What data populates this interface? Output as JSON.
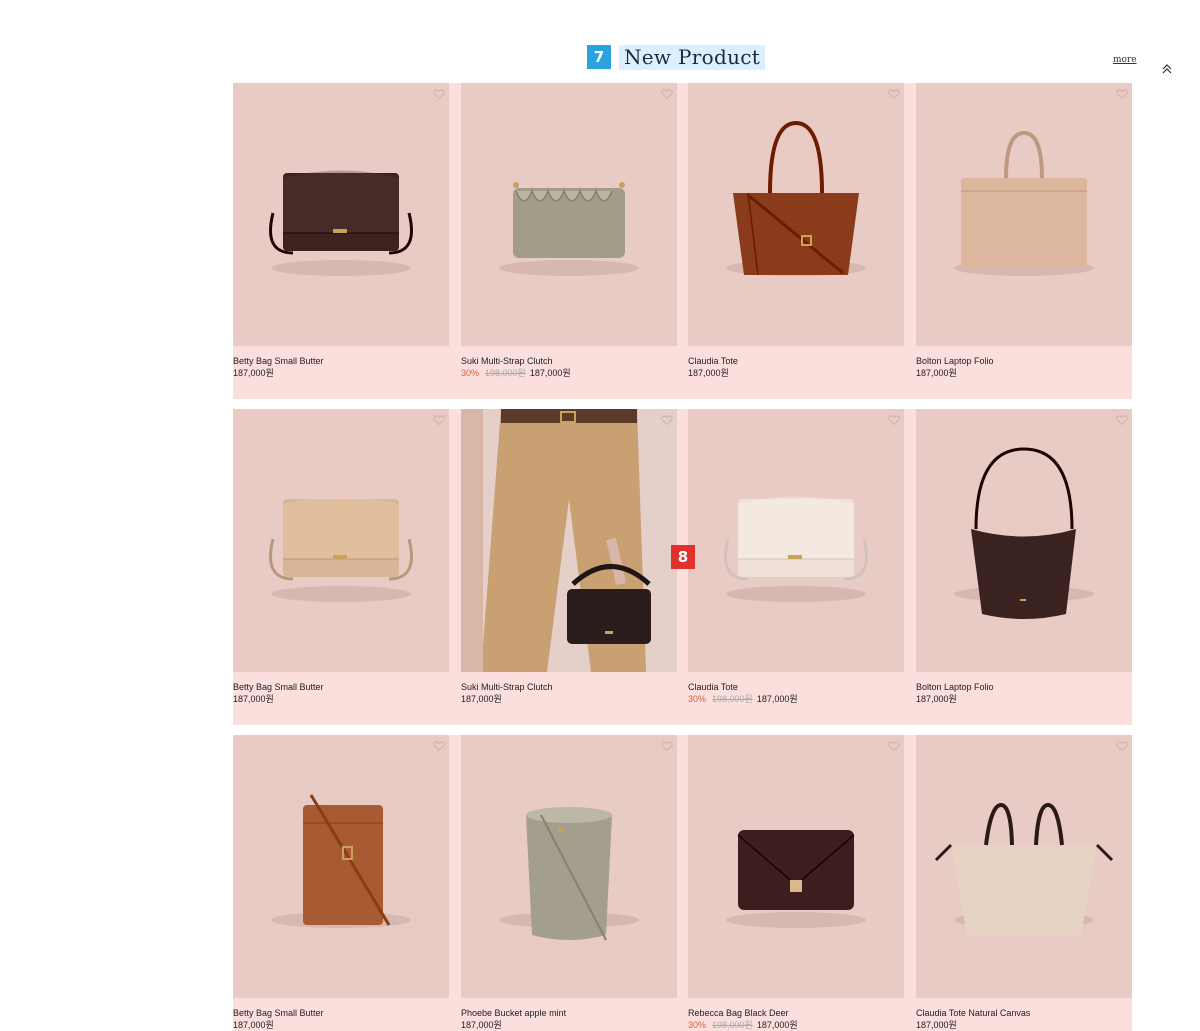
{
  "section": {
    "badge_top": "7",
    "title": "New Product",
    "more_label": "more",
    "badge_mid": "8"
  },
  "colors": {
    "card_bg": "#e9cbc6",
    "row_bg": "#fbdfdd",
    "discount": "#d9603a",
    "title_highlight": "#dcefff"
  },
  "products": [
    {
      "name": "Betty Bag Small Butter",
      "discount": "",
      "original_price": "",
      "price": "187,000원",
      "bag_color": "#3e2220",
      "style": "flap-crossbody"
    },
    {
      "name": "Suki Multi-Strap Clutch",
      "discount": "30%",
      "original_price": "198,000원",
      "price": "187,000원",
      "bag_color": "#a29c88",
      "style": "ruffle"
    },
    {
      "name": "Claudia Tote",
      "discount": "",
      "original_price": "",
      "price": "187,000원",
      "bag_color": "#8a3b1c",
      "style": "tote"
    },
    {
      "name": "Bolton Laptop Folio",
      "discount": "",
      "original_price": "",
      "price": "187,000원",
      "bag_color": "#dcb79e",
      "style": "laptop"
    },
    {
      "name": "Betty Bag Small Butter",
      "discount": "",
      "original_price": "",
      "price": "187,000원",
      "bag_color": "#d7b596",
      "style": "flap-crossbody"
    },
    {
      "name": "Suki Multi-Strap Clutch",
      "discount": "",
      "original_price": "",
      "price": "187,000원",
      "bag_color": "#2a1c1b",
      "style": "model"
    },
    {
      "name": "Claudia Tote",
      "discount": "30%",
      "original_price": "198,000원",
      "price": "187,000원",
      "bag_color": "#efe0d8",
      "style": "flap-crossbody"
    },
    {
      "name": "Bolton Laptop Folio",
      "discount": "",
      "original_price": "",
      "price": "187,000원",
      "bag_color": "#3a2220",
      "style": "bucket-hobo"
    },
    {
      "name": "Betty Bag Small Butter",
      "discount": "",
      "original_price": "",
      "price": "187,000원",
      "bag_color": "#a85a33",
      "style": "phone"
    },
    {
      "name": "Phoebe Bucket apple mint",
      "discount": "",
      "original_price": "",
      "price": "187,000원",
      "bag_color": "#a49e8c",
      "style": "bucket"
    },
    {
      "name": "Rebecca Bag Black Deer",
      "discount": "30%",
      "original_price": "198,000원",
      "price": "187,000원",
      "bag_color": "#3c1e1f",
      "style": "envelope"
    },
    {
      "name": "Claudia Tote Natural Canvas",
      "discount": "",
      "original_price": "",
      "price": "187,000원",
      "bag_color": "#e6d3c4",
      "style": "canvas-tote"
    }
  ]
}
